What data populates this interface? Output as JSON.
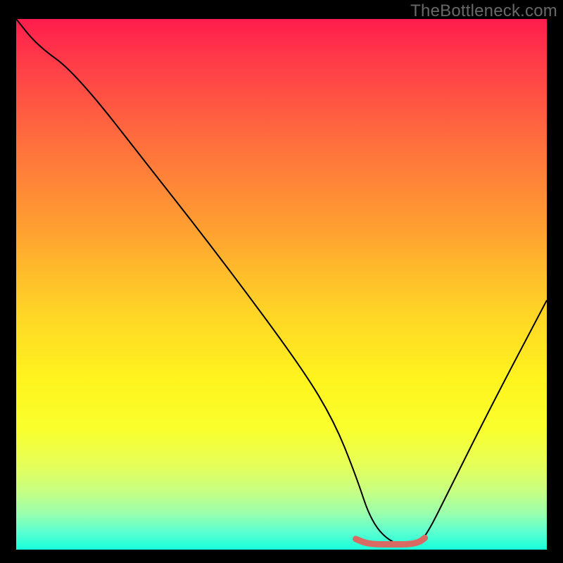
{
  "watermark": "TheBottleneck.com",
  "chart_data": {
    "type": "line",
    "title": "",
    "xlabel": "",
    "ylabel": "",
    "xlim": [
      0,
      100
    ],
    "ylim": [
      0,
      100
    ],
    "series": [
      {
        "name": "bottleneck-curve",
        "x": [
          0,
          4,
          11,
          26,
          40,
          54,
          60,
          64,
          67,
          71,
          75,
          77,
          82,
          90,
          100
        ],
        "values": [
          100,
          95,
          90,
          71,
          53,
          34,
          24,
          14,
          5,
          1,
          1,
          2,
          12,
          28,
          47
        ],
        "color": "#000000",
        "width": 2
      },
      {
        "name": "optimal-zone",
        "x": [
          64,
          66,
          68,
          71,
          74,
          76,
          77
        ],
        "values": [
          2.0,
          1.2,
          1.0,
          1.0,
          1.0,
          1.4,
          2.2
        ],
        "color": "#d96a63",
        "width": 9
      }
    ],
    "gradient_stops": [
      {
        "pos": 0,
        "color": "#ff1d4d"
      },
      {
        "pos": 0.08,
        "color": "#ff3b49"
      },
      {
        "pos": 0.22,
        "color": "#ff6b3e"
      },
      {
        "pos": 0.38,
        "color": "#ff9b32"
      },
      {
        "pos": 0.55,
        "color": "#ffd426"
      },
      {
        "pos": 0.68,
        "color": "#fff41e"
      },
      {
        "pos": 0.77,
        "color": "#faff2c"
      },
      {
        "pos": 0.84,
        "color": "#e6ff58"
      },
      {
        "pos": 0.89,
        "color": "#c7ff83"
      },
      {
        "pos": 0.93,
        "color": "#9dffab"
      },
      {
        "pos": 0.965,
        "color": "#5effcf"
      },
      {
        "pos": 1.0,
        "color": "#17ffdb"
      }
    ]
  }
}
